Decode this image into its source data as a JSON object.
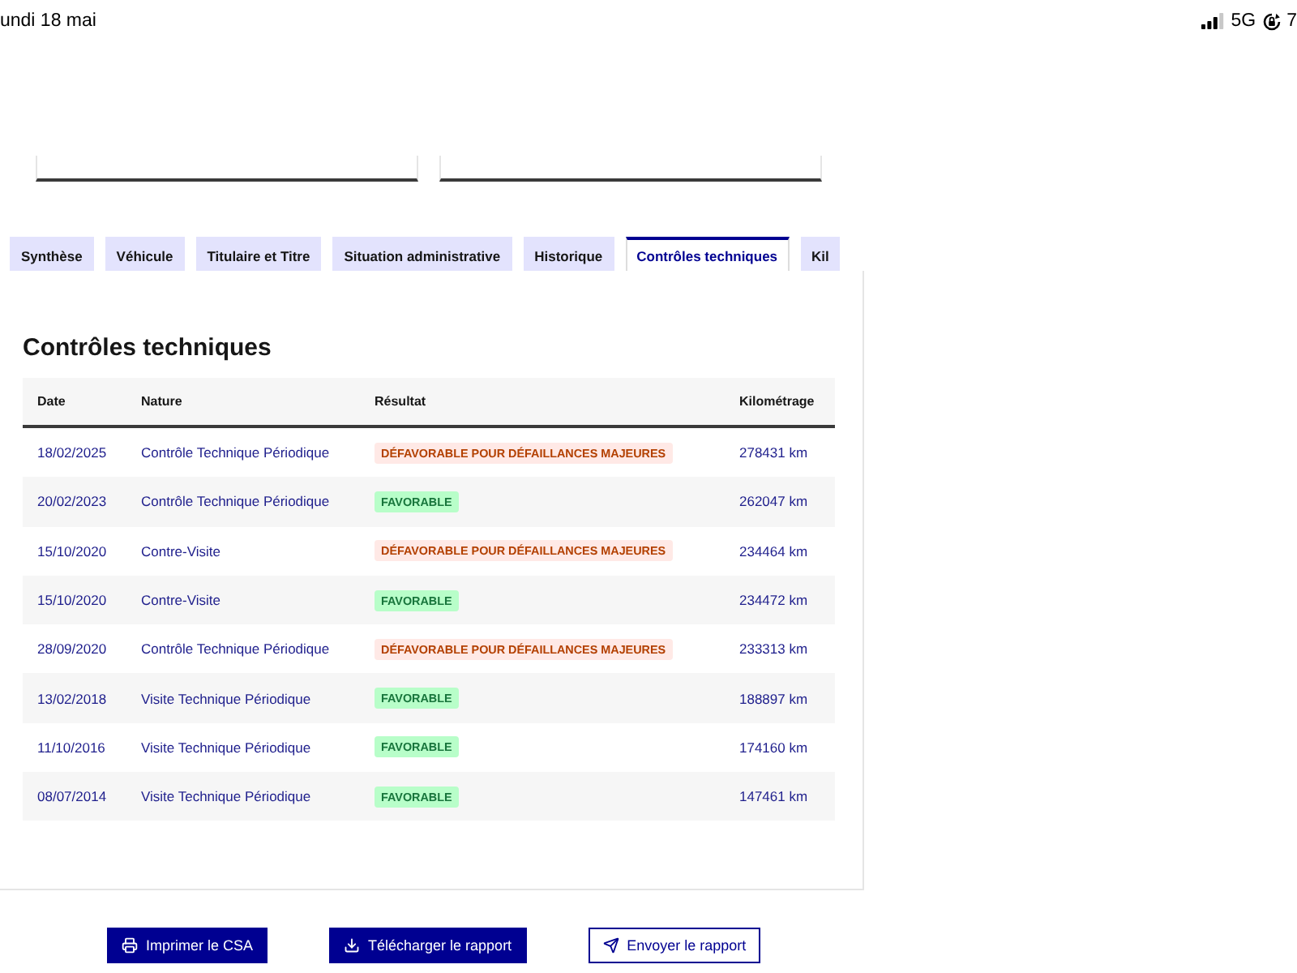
{
  "status_bar": {
    "date": "undi 18 mai",
    "network": "5G",
    "battery": "7"
  },
  "tabs": [
    {
      "label": "Synthèse",
      "selected": false
    },
    {
      "label": "Véhicule",
      "selected": false
    },
    {
      "label": "Titulaire et Titre",
      "selected": false
    },
    {
      "label": "Situation administrative",
      "selected": false
    },
    {
      "label": "Historique",
      "selected": false
    },
    {
      "label": "Contrôles techniques",
      "selected": true
    },
    {
      "label": "Kil",
      "selected": false
    }
  ],
  "section": {
    "title": "Contrôles techniques"
  },
  "table": {
    "columns": [
      "Date",
      "Nature",
      "Résultat",
      "Kilométrage"
    ],
    "rows": [
      {
        "date": "18/02/2025",
        "nature": "Contrôle Technique Périodique",
        "result": {
          "label": "DÉFAVORABLE POUR DÉFAILLANCES MAJEURES",
          "kind": "unfavorable"
        },
        "mileage": "278431 km"
      },
      {
        "date": "20/02/2023",
        "nature": "Contrôle Technique Périodique",
        "result": {
          "label": "FAVORABLE",
          "kind": "favorable"
        },
        "mileage": "262047 km"
      },
      {
        "date": "15/10/2020",
        "nature": "Contre-Visite",
        "result": {
          "label": "DÉFAVORABLE POUR DÉFAILLANCES MAJEURES",
          "kind": "unfavorable"
        },
        "mileage": "234464 km"
      },
      {
        "date": "15/10/2020",
        "nature": "Contre-Visite",
        "result": {
          "label": "FAVORABLE",
          "kind": "favorable"
        },
        "mileage": "234472 km"
      },
      {
        "date": "28/09/2020",
        "nature": "Contrôle Technique Périodique",
        "result": {
          "label": "DÉFAVORABLE POUR DÉFAILLANCES MAJEURES",
          "kind": "unfavorable"
        },
        "mileage": "233313 km"
      },
      {
        "date": "13/02/2018",
        "nature": "Visite Technique Périodique",
        "result": {
          "label": "FAVORABLE",
          "kind": "favorable"
        },
        "mileage": "188897 km"
      },
      {
        "date": "11/10/2016",
        "nature": "Visite Technique Périodique",
        "result": {
          "label": "FAVORABLE",
          "kind": "favorable"
        },
        "mileage": "174160 km"
      },
      {
        "date": "08/07/2014",
        "nature": "Visite Technique Périodique",
        "result": {
          "label": "FAVORABLE",
          "kind": "favorable"
        },
        "mileage": "147461 km"
      }
    ]
  },
  "buttons": [
    {
      "label": "Imprimer le CSA",
      "kind": "primary"
    },
    {
      "label": "Télécharger le rapport",
      "kind": "primary"
    },
    {
      "label": "Envoyer le rapport",
      "kind": "secondary"
    }
  ]
}
